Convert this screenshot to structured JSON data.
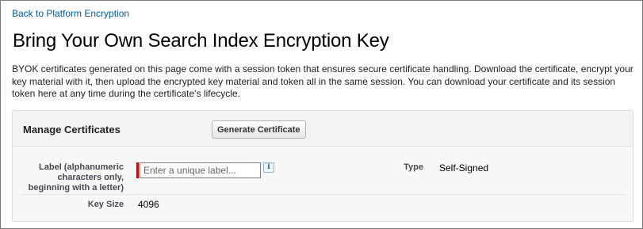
{
  "back_link": "Back to Platform Encryption",
  "page_title": "Bring Your Own Search Index Encryption Key",
  "intro": "BYOK certificates generated on this page come with a session token that ensures secure certificate handling. Download the certificate, encrypt your key material with it, then upload the encrypted key material and token all in the same session. You can download your certificate and its session token here at any time during the certificate’s lifecycle.",
  "panel": {
    "title": "Manage Certificates",
    "generate_button": "Generate Certificate"
  },
  "form": {
    "label_field": {
      "label": "Label (alphanumeric characters only, beginning with a letter)",
      "placeholder": "Enter a unique label...",
      "value": "",
      "info_icon": "info-icon"
    },
    "type": {
      "label": "Type",
      "value": "Self-Signed"
    },
    "key_size": {
      "label": "Key Size",
      "value": "4096"
    }
  },
  "colors": {
    "link": "#015ba7",
    "required_marker": "#cc0000",
    "panel_bg": "#f8f8f8"
  }
}
